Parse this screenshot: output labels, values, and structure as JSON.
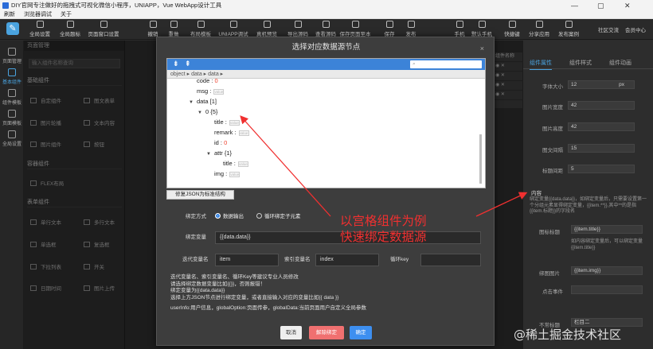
{
  "window": {
    "title": "DIY官网专注做好的拖拽式可视化微信小程序，UNIAPP，Vue WebApp设计工具",
    "controls": [
      "—",
      "▢",
      "✕"
    ]
  },
  "menubar": {
    "items": [
      "刷新",
      "浏览器调试",
      "关于"
    ]
  },
  "toolbar": {
    "left": [
      "全局设置",
      "全局题标",
      "页面窗口设置"
    ],
    "middle": [
      "撤销",
      "重做",
      "布局模板",
      "UNIAPP调试",
      "真机预览",
      "导出源码",
      "查看源码",
      "保存页面至本地",
      "保存",
      "发布"
    ],
    "right": [
      "手机",
      "默认手机",
      "快捷键",
      "分享应用",
      "发布案例",
      "社区交流",
      "会员中心"
    ]
  },
  "left_nav": {
    "items": [
      "页面管理",
      "基本组件",
      "组件模板",
      "页面模板",
      "全局设置"
    ],
    "active_index": 1
  },
  "left_panel": {
    "header": "页面管理",
    "search_placeholder": "输入组件名称查询",
    "groups": [
      "基础组件",
      "容器组件",
      "表单组件"
    ],
    "components": [
      "自定组件",
      "图文表单",
      "图片轮播",
      "文本内容",
      "图片组件",
      "按钮",
      "FLEX布局",
      "单行文本",
      "多行文本",
      "单选框",
      "复选框",
      "下拉列表",
      "开关",
      "日期时间",
      "图片上传"
    ]
  },
  "right_panel": {
    "tabs": [
      "组件属性",
      "组件样式",
      "组件动画"
    ],
    "active_tab": 0,
    "rows": [
      {
        "label": "字体大小",
        "value": "12",
        "unit": "px"
      },
      {
        "label": "图片宽度",
        "value": "42"
      },
      {
        "label": "图片高度",
        "value": "42"
      },
      {
        "label": "图文间隔",
        "value": "15"
      },
      {
        "label": "标题间距",
        "value": "5"
      }
    ],
    "section_title": "内容",
    "desc": "绑定变量{{data.data}}，如绑定变量后，只需要设置第一个分组元素显得绑定变量，{{item.**}},其中**的是指{{item.标题}}的字段名",
    "bind_items": [
      {
        "check": "图标标题",
        "placeholder": "{{item.title}}",
        "tip": "如内容绑定变量后，可以绑定变量{{item.title}}"
      },
      {
        "check": "绑图图片",
        "placeholder": "{{item.img}}"
      },
      {
        "label": "点击事件",
        "value": ""
      },
      {
        "check": "不常标题",
        "value": "栏目二"
      }
    ]
  },
  "strip": {
    "label": "组件名称"
  },
  "dialog": {
    "title": "选择对应数据源节点",
    "close": "×",
    "json_toolbar": {
      "expand": "⇟",
      "collapse": "⇞"
    },
    "search_placeholder": "",
    "breadcrumb": "object ▸ data ▸ data ▸",
    "json_lines": [
      {
        "key": "code",
        "sep": ":",
        "value": "0",
        "indent": 0,
        "arrow": ""
      },
      {
        "key": "msg",
        "sep": ":",
        "value": "",
        "indent": 0,
        "arrow": "",
        "box": "value"
      },
      {
        "key": "data",
        "sep": "",
        "value": "[1]",
        "indent": 0,
        "arrow": "▼",
        "is_head": true
      },
      {
        "key": "0",
        "sep": "",
        "value": "{5}",
        "indent": 1,
        "arrow": "▼",
        "is_head": true
      },
      {
        "key": "title",
        "sep": ":",
        "value": "",
        "indent": 2,
        "arrow": "",
        "box": "value"
      },
      {
        "key": "remark",
        "sep": ":",
        "value": "",
        "indent": 2,
        "arrow": "",
        "box": "value"
      },
      {
        "key": "id",
        "sep": ":",
        "value": "0",
        "indent": 2,
        "arrow": ""
      },
      {
        "key": "attr",
        "sep": "",
        "value": "{1}",
        "indent": 2,
        "arrow": "▼",
        "is_head": true
      },
      {
        "key": "title",
        "sep": ":",
        "value": "",
        "indent": 3,
        "arrow": "",
        "box": "value"
      },
      {
        "key": "img",
        "sep": ":",
        "value": "",
        "indent": 2,
        "arrow": "",
        "box": "value"
      }
    ],
    "fix_button": "修复JSON为标准结构",
    "bind_mode_label": "绑定方式",
    "bind_modes": [
      "数据输出",
      "循环绑定子元素"
    ],
    "bind_mode_selected": 0,
    "bind_var_label": "绑定变量",
    "bind_var_value": "{{data.data}}",
    "iter_var_label": "迭代变量名",
    "iter_var_value": "item",
    "index_var_label": "索引变量名",
    "index_var_value": "index",
    "loop_key_label": "循环key",
    "loop_key_value": "",
    "notes": [
      "迭代变量名、索引变量名、循环Key等建议专业人员修改",
      "请选择绑定数据变量比如{{}}，否则报错！",
      "绑定变量为{{data.data}}",
      "选择上方JSON节点进行绑定变量，或者直接输入对应的变量比如{{ data }}",
      "userInfo:用户信息，globalOption:页面传参，globalData:当前页面用户自定义全局参数"
    ],
    "buttons": {
      "cancel": "取消",
      "unbind": "解除绑定",
      "confirm": "确定"
    }
  },
  "annotation": {
    "line1": "以宫格组件为例",
    "line2": "快速绑定数据源",
    "color": "#f03030"
  },
  "watermark": "@稀土掘金技术社区",
  "colors": {
    "accent": "#3c83d8",
    "danger": "#f07070",
    "confirm": "#3d8ff0"
  }
}
